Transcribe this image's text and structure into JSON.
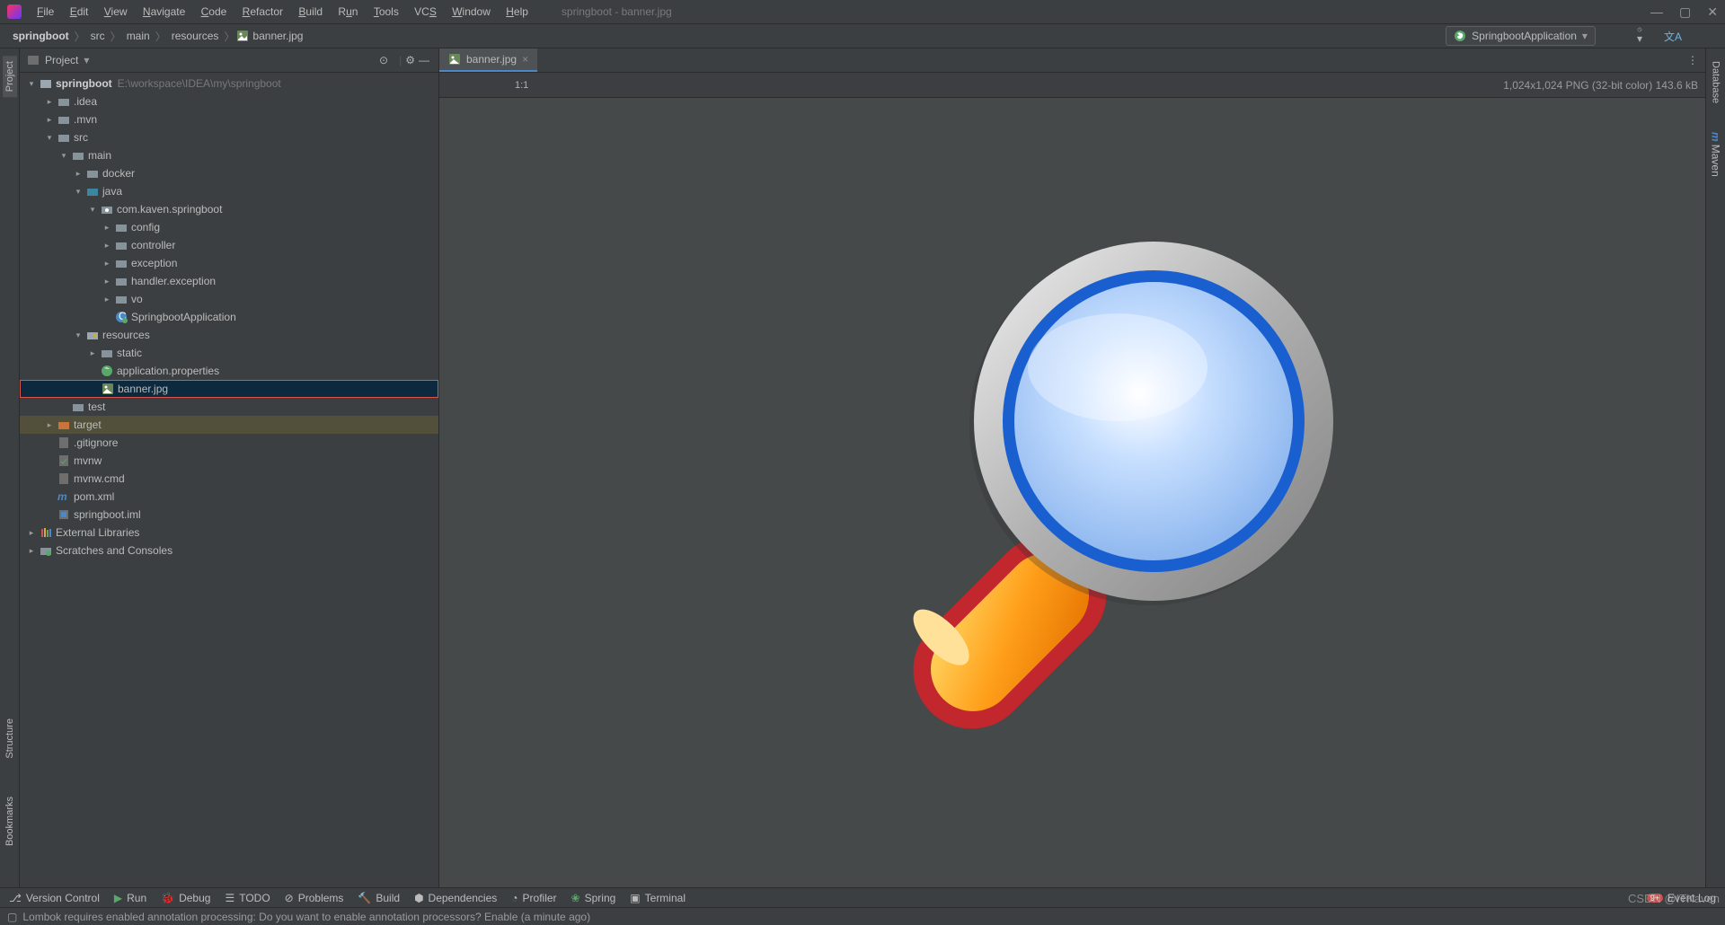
{
  "window": {
    "title": "springboot - banner.jpg"
  },
  "menu": [
    "File",
    "Edit",
    "View",
    "Navigate",
    "Code",
    "Refactor",
    "Build",
    "Run",
    "Tools",
    "VCS",
    "Window",
    "Help"
  ],
  "breadcrumbs": [
    "springboot",
    "src",
    "main",
    "resources",
    "banner.jpg"
  ],
  "runConfig": {
    "label": "SpringbootApplication"
  },
  "projectPanel": {
    "title": "Project"
  },
  "tree": {
    "root": {
      "label": "springboot",
      "path": "E:\\workspace\\IDEA\\my\\springboot"
    },
    "idea": ".idea",
    "mvn": ".mvn",
    "src": "src",
    "main": "main",
    "docker": "docker",
    "java": "java",
    "pkg": "com.kaven.springboot",
    "config": "config",
    "controller": "controller",
    "exception": "exception",
    "handler": "handler.exception",
    "vo": "vo",
    "app": "SpringbootApplication",
    "resources": "resources",
    "static": "static",
    "appprops": "application.properties",
    "banner": "banner.jpg",
    "test": "test",
    "target": "target",
    "gitignore": ".gitignore",
    "mvnw": "mvnw",
    "mvnwcmd": "mvnw.cmd",
    "pom": "pom.xml",
    "iml": "springboot.iml",
    "extlib": "External Libraries",
    "scratch": "Scratches and Consoles"
  },
  "editorTab": {
    "label": "banner.jpg"
  },
  "imageToolbar": {
    "oneToOne": "1:1",
    "status": "1,024x1,024 PNG (32-bit color) 143.6 kB"
  },
  "leftTabs": {
    "project": "Project",
    "structure": "Structure",
    "bookmarks": "Bookmarks"
  },
  "rightTabs": {
    "database": "Database",
    "maven": "Maven"
  },
  "bottomTabs": {
    "vc": "Version Control",
    "run": "Run",
    "debug": "Debug",
    "todo": "TODO",
    "problems": "Problems",
    "build": "Build",
    "deps": "Dependencies",
    "profiler": "Profiler",
    "spring": "Spring",
    "terminal": "Terminal",
    "eventlog": "Event Log"
  },
  "status": {
    "msg": "Lombok requires enabled annotation processing: Do you want to enable annotation processors? Enable (a minute ago)"
  },
  "watermark": "CSDN @ITKaven"
}
